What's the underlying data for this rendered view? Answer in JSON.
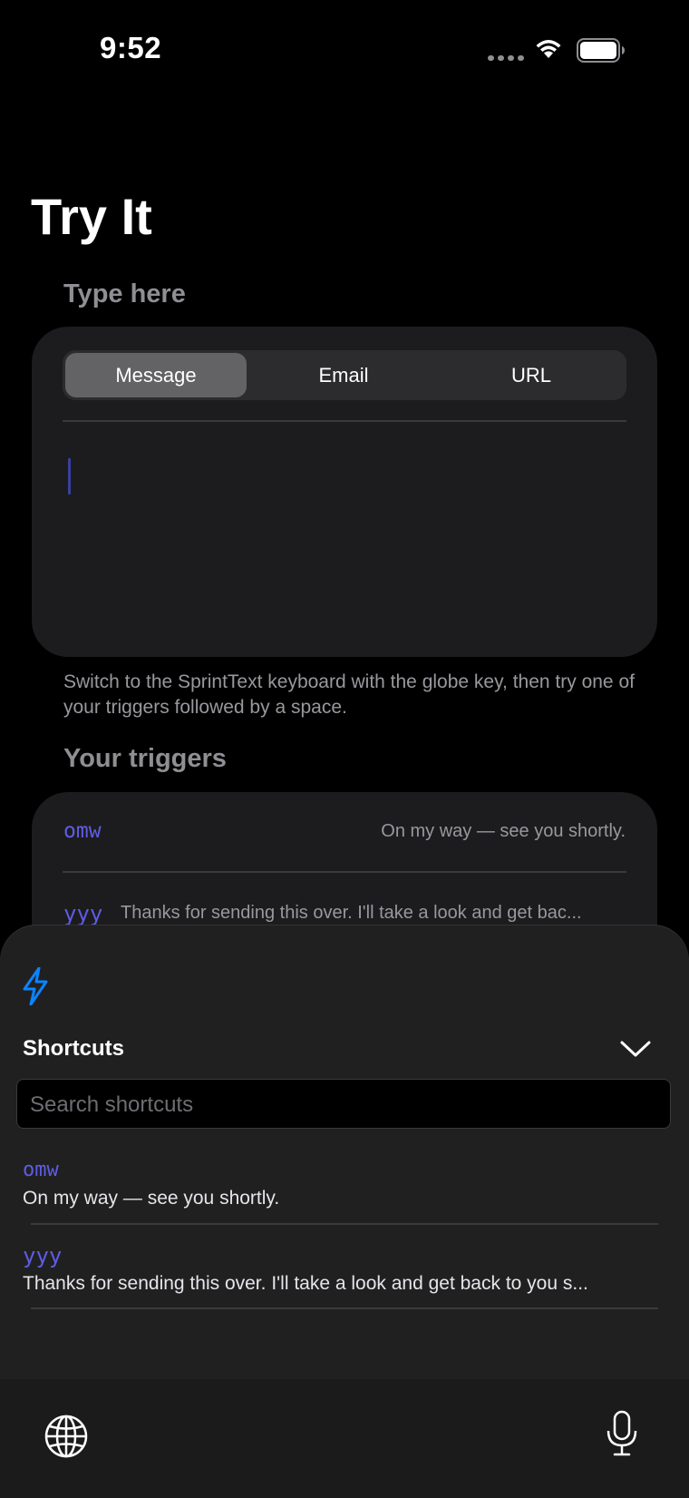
{
  "status_bar": {
    "time": "9:52"
  },
  "page": {
    "title": "Try It",
    "type_here_label": "Type here",
    "tabs": [
      "Message",
      "Email",
      "URL"
    ],
    "active_tab": "Message",
    "hint": "Switch to the SprintText keyboard with the globe key, then try one of your triggers followed by a space.",
    "triggers_label": "Your triggers",
    "triggers": [
      {
        "key": "omw",
        "value": "On my way — see you shortly."
      },
      {
        "key": "yyy",
        "value": "Thanks for sending this over. I'll take a look and get bac..."
      }
    ]
  },
  "keyboard": {
    "panel_title": "Shortcuts",
    "search_placeholder": "Search shortcuts",
    "shortcuts": [
      {
        "key": "omw",
        "value": "On my way — see you shortly."
      },
      {
        "key": "yyy",
        "value": "Thanks for sending this over. I'll take a look and get back to you s..."
      }
    ]
  },
  "colors": {
    "accent": "#5e5ce6",
    "bolt": "#0a84ff",
    "background": "#000000",
    "card": "#1c1c1e"
  },
  "icons": [
    "wifi-icon",
    "battery-icon",
    "bolt-icon",
    "chevron-down-icon",
    "globe-icon",
    "mic-icon"
  ]
}
